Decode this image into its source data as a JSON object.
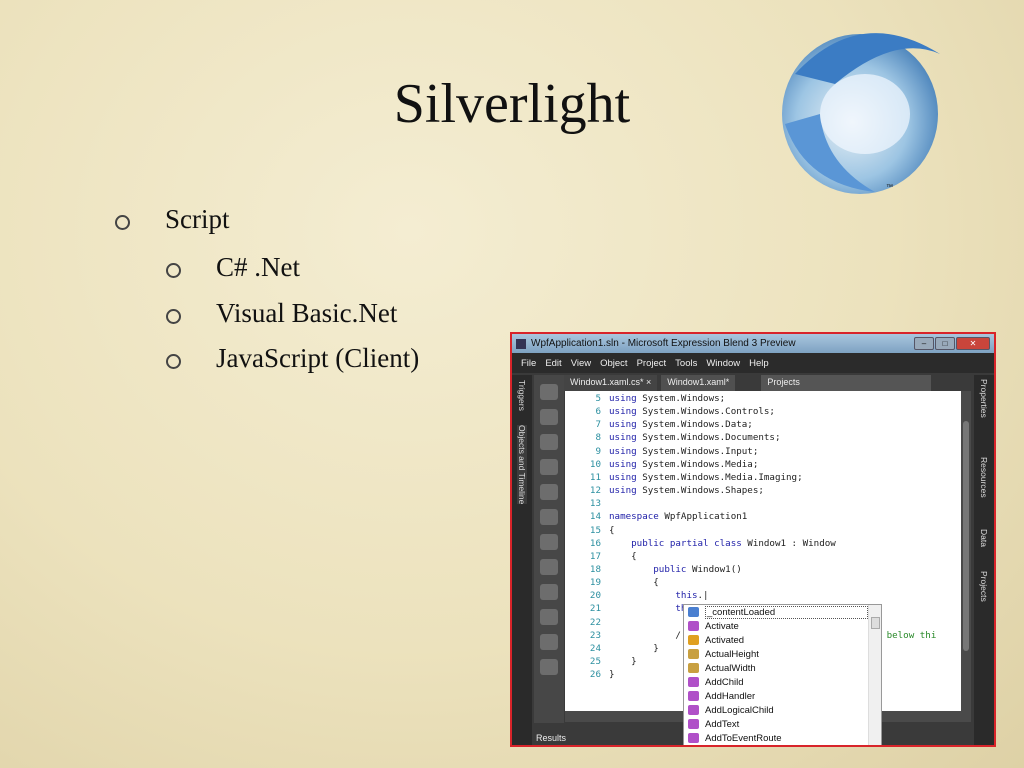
{
  "slide": {
    "title": "Silverlight",
    "logo_mark": "™",
    "bullets": [
      {
        "text": "Script",
        "level": 1
      },
      {
        "text": "C# .Net",
        "level": 2
      },
      {
        "text": "Visual Basic.Net",
        "level": 2
      },
      {
        "text": "JavaScript (Client)",
        "level": 2
      }
    ]
  },
  "app": {
    "title": "WpfApplication1.sln - Microsoft Expression Blend 3 Preview",
    "menu": [
      "File",
      "Edit",
      "View",
      "Object",
      "Project",
      "Tools",
      "Window",
      "Help"
    ],
    "tabs": [
      "Window1.xaml.cs* ×",
      "Window1.xaml*",
      "Projects"
    ],
    "left_panels": [
      "Triggers",
      "Objects and Timeline"
    ],
    "right_panels": [
      "Properties",
      "Resources",
      "Data",
      "Projects"
    ],
    "results": "Results",
    "code": [
      {
        "n": "5",
        "k": "using",
        "r": " System.Windows;"
      },
      {
        "n": "6",
        "k": "using",
        "r": " System.Windows.Controls;"
      },
      {
        "n": "7",
        "k": "using",
        "r": " System.Windows.Data;"
      },
      {
        "n": "8",
        "k": "using",
        "r": " System.Windows.Documents;"
      },
      {
        "n": "9",
        "k": "using",
        "r": " System.Windows.Input;"
      },
      {
        "n": "10",
        "k": "using",
        "r": " System.Windows.Media;"
      },
      {
        "n": "11",
        "k": "using",
        "r": " System.Windows.Media.Imaging;"
      },
      {
        "n": "12",
        "k": "using",
        "r": " System.Windows.Shapes;"
      },
      {
        "n": "13",
        "k": "",
        "r": ""
      },
      {
        "n": "14",
        "k": "namespace",
        "r": " WpfApplication1"
      },
      {
        "n": "15",
        "k": "",
        "r": "{"
      },
      {
        "n": "16",
        "k": "    public partial class",
        "r": " Window1 : Window"
      },
      {
        "n": "17",
        "k": "",
        "r": "    {"
      },
      {
        "n": "18",
        "k": "        public",
        "r": " Window1()"
      },
      {
        "n": "19",
        "k": "",
        "r": "        {"
      },
      {
        "n": "20",
        "k": "            this",
        "r": ".|"
      },
      {
        "n": "21",
        "k": "            th",
        "r": ""
      },
      {
        "n": "22",
        "k": "",
        "r": ""
      },
      {
        "n": "23",
        "k": "",
        "r": "            /",
        "c": "tion below thi"
      },
      {
        "n": "24",
        "k": "",
        "r": "        }"
      },
      {
        "n": "25",
        "k": "",
        "r": "    }"
      },
      {
        "n": "26",
        "k": "",
        "r": "}"
      }
    ],
    "autocomplete": [
      {
        "label": "_contentLoaded",
        "icon": "field-icon",
        "color": "#4a7fd0"
      },
      {
        "label": "Activate",
        "icon": "method-icon",
        "color": "#b050c8"
      },
      {
        "label": "Activated",
        "icon": "event-icon",
        "color": "#e0a020"
      },
      {
        "label": "ActualHeight",
        "icon": "property-icon",
        "color": "#c8a040"
      },
      {
        "label": "ActualWidth",
        "icon": "property-icon",
        "color": "#c8a040"
      },
      {
        "label": "AddChild",
        "icon": "method-icon",
        "color": "#b050c8"
      },
      {
        "label": "AddHandler",
        "icon": "method-icon",
        "color": "#b050c8"
      },
      {
        "label": "AddLogicalChild",
        "icon": "method-icon",
        "color": "#b050c8"
      },
      {
        "label": "AddText",
        "icon": "method-icon",
        "color": "#b050c8"
      },
      {
        "label": "AddToEventRoute",
        "icon": "method-icon",
        "color": "#b050c8"
      }
    ]
  }
}
